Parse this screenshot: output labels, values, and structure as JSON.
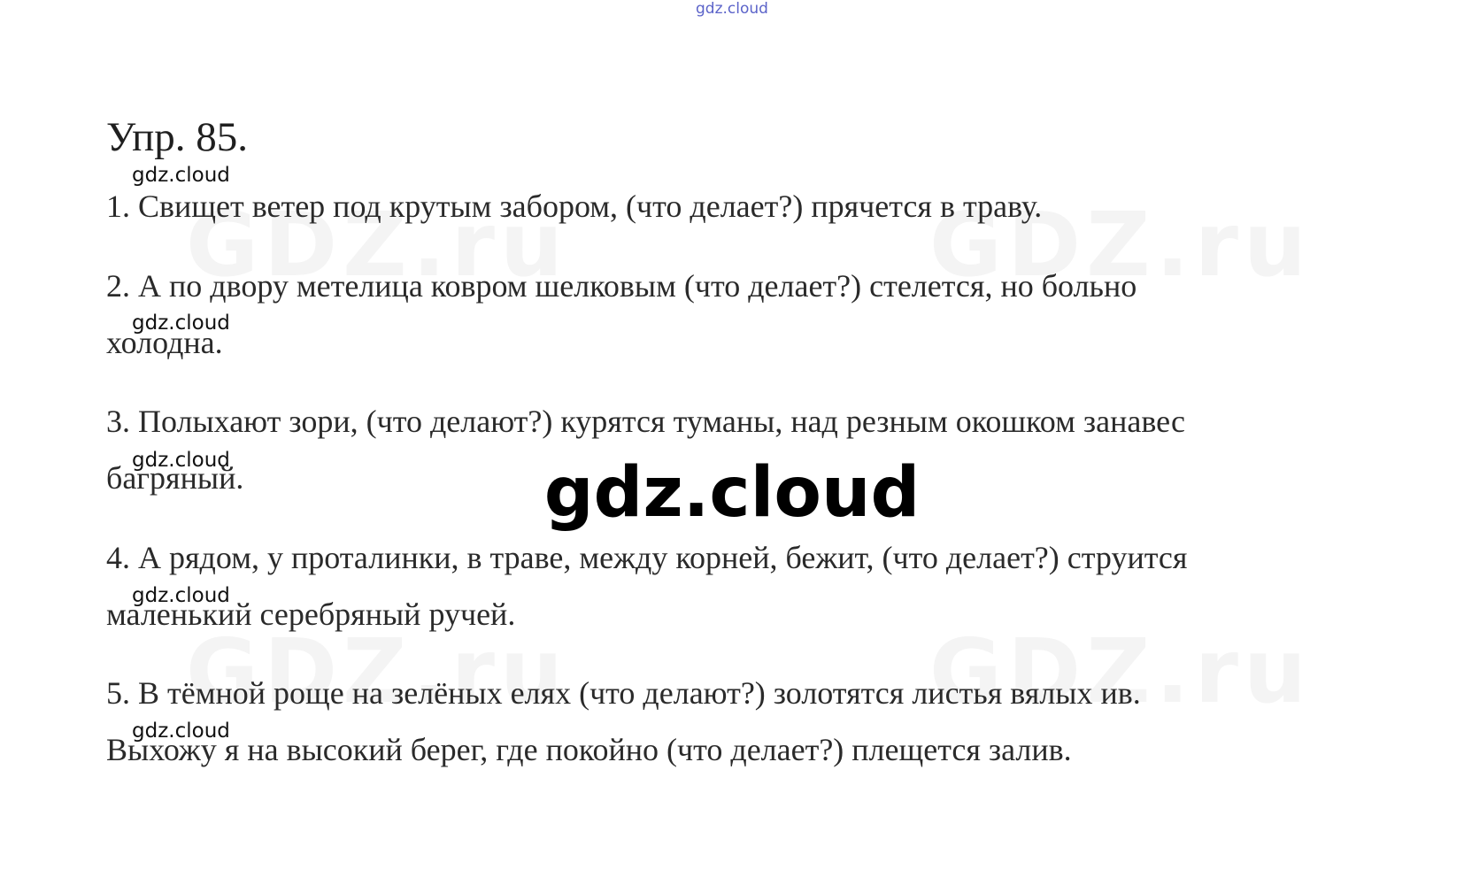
{
  "watermark": {
    "top": "gdz.cloud",
    "small": "gdz.cloud",
    "big": "gdz.cloud",
    "faint": "GDZ.ru"
  },
  "exercise": {
    "title": "Упр. 85.",
    "items": [
      {
        "lines": [
          "1. Свищет ветер под крутым забором, (что делает?) прячется в траву."
        ]
      },
      {
        "lines": [
          "2. А по двору метелица ковром шелковым (что делает?) стелется, но больно",
          "холодна."
        ]
      },
      {
        "lines": [
          "3. Полыхают зори, (что делают?) курятся туманы, над резным окошком занавес",
          "багряный."
        ]
      },
      {
        "lines": [
          "4. А рядом, у проталинки, в траве, между корней, бежит, (что делает?) струится",
          "маленький серебряный ручей."
        ]
      },
      {
        "lines": [
          "5. В тёмной роще на зелёных елях (что делают?)  золотятся листья вялых ив.",
          "Выхожу я на высокий берег, где покойно (что делает?) плещется залив."
        ]
      }
    ]
  },
  "colors": {
    "text": "#2a2a2a",
    "top_watermark": "#5b63c9",
    "faint_watermark": "#f4f4f4"
  }
}
